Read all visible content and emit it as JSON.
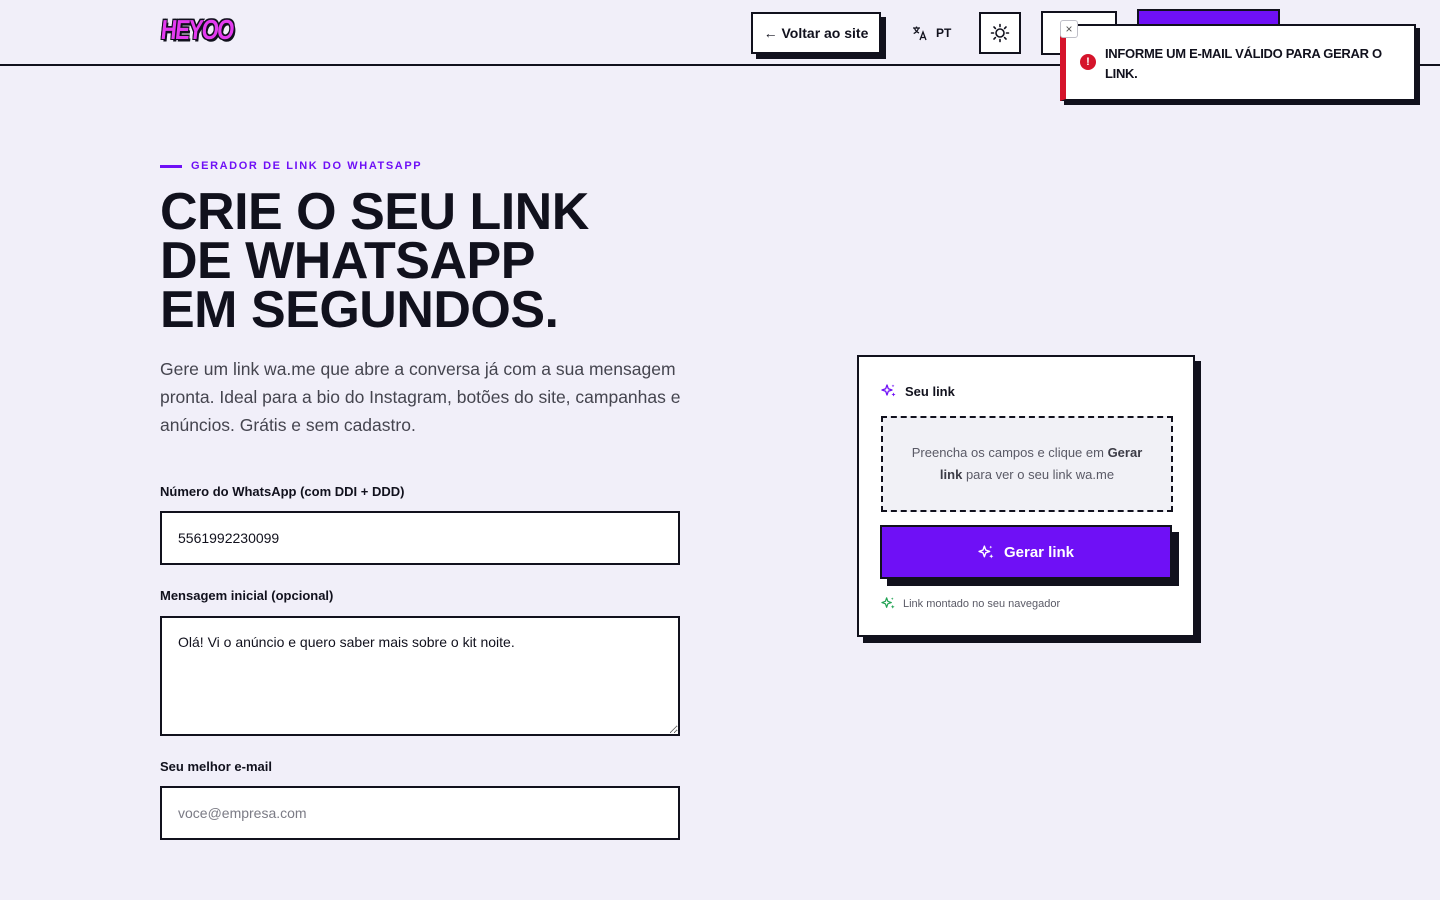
{
  "header": {
    "logo_text": "HEYOO",
    "back_button_label": "← Voltar ao site",
    "language_label": "PT"
  },
  "toast": {
    "message": "INFORME UM E-MAIL VÁLIDO PARA GERAR O LINK.",
    "close_glyph": "×",
    "icon_glyph": "!"
  },
  "hero": {
    "eyebrow": "GERADOR DE LINK DO WHATSAPP",
    "title_lines": [
      "CRIE O SEU LINK",
      "DE WHATSAPP",
      "EM SEGUNDOS."
    ],
    "subtitle": "Gere um link wa.me que abre a conversa já com a sua mensagem pronta. Ideal para a bio do Instagram, botões do site, campanhas e anúncios. Grátis e sem cadastro."
  },
  "form": {
    "phone_label": "Número do WhatsApp (com DDI + DDD)",
    "phone_value": "5561992230099",
    "message_label": "Mensagem inicial (opcional)",
    "message_value": "Olá! Vi o anúncio e quero saber mais sobre o kit noite.",
    "email_label": "Seu melhor e-mail",
    "email_value": "",
    "email_placeholder": "voce@empresa.com"
  },
  "card": {
    "title": "Seu link",
    "placeholder_part1": "Preencha os campos e clique em ",
    "placeholder_bold": "Gerar link",
    "placeholder_part2": " para ver o seu link wa.me",
    "button_label": "Gerar link",
    "footer_note": "Link montado no seu navegador"
  },
  "colors": {
    "accent": "#6f10f6",
    "error": "#d5142b",
    "success": "#22a354",
    "ink": "#11111d",
    "background": "#f1eff9"
  },
  "icons": [
    "translate-icon",
    "sun-icon",
    "sparkle-icon",
    "error-icon",
    "close-icon"
  ]
}
